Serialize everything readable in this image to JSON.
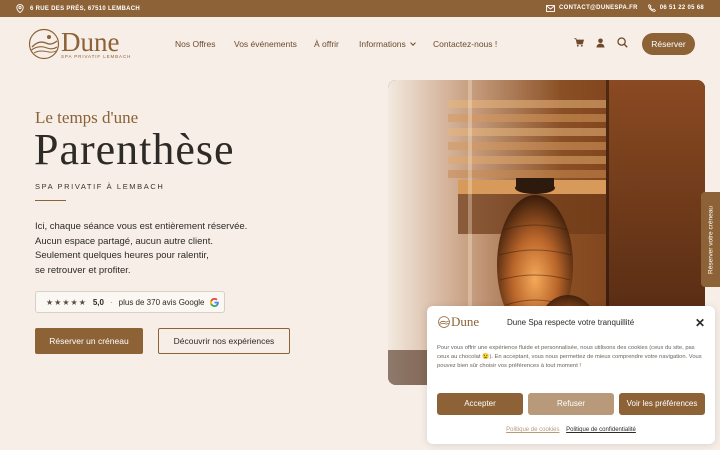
{
  "topbar": {
    "address": "6 RUE DES PRÉS, 67510 LEMBACH",
    "email": "CONTACT@DUNESPA.FR",
    "phone": "06 51 22 05 68"
  },
  "brand": {
    "name": "Dune",
    "tagline": "SPA PRIVATIF LEMBACH",
    "primary_color": "#8c6236"
  },
  "nav": {
    "items": [
      {
        "label": "Nos Offres"
      },
      {
        "label": "Vos événements"
      },
      {
        "label": "À offrir"
      },
      {
        "label": "Informations"
      },
      {
        "label": "Contactez-nous !"
      }
    ],
    "cart_icon": "cart-icon",
    "account_icon": "user-icon",
    "search_icon": "search-icon",
    "cta_label": "Réserver"
  },
  "hero": {
    "subtitle": "Le temps d'une",
    "title": "Parenthèse",
    "tagline": "SPA PRIVATIF À LEMBACH",
    "lines": [
      "Ici, chaque séance vous est entièrement réservée.",
      "Aucun espace partagé, aucun autre client.",
      "Seulement quelques heures pour ralentir,",
      "se retrouver et profiter."
    ],
    "rating": {
      "stars": "★★★★★",
      "score": "5,0",
      "reviews": "plus de 370 avis Google"
    },
    "primary_button": "Réserver un créneau",
    "secondary_button": "Découvrir nos expériences"
  },
  "side_tab": "Réserver votre créneau",
  "cookie": {
    "logo": "Dune",
    "title": "Dune Spa respecte votre tranquillité",
    "body": "Pour vous offrir une expérience fluide et personnalisée, nous utilisons des cookies (ceux du site, pas ceux au chocolat 😉). En acceptant, vous nous permettez de mieux comprendre votre navigation. Vous pouvez bien sûr choisir vos préférences à tout moment !",
    "accept": "Accepter",
    "refuse": "Refuser",
    "preferences": "Voir les préférences",
    "cookie_policy": "Politique de cookies",
    "privacy_policy": "Politique de confidentialité"
  }
}
